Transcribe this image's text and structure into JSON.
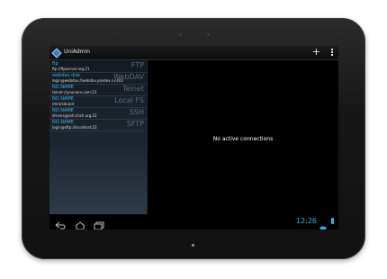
{
  "app": {
    "title": "UniAdmin"
  },
  "actionbar": {
    "add_icon": "plus-icon",
    "overflow_icon": "overflow-menu-icon"
  },
  "connections": [
    {
      "name": "ftp",
      "address": "ftp://ftpserver.org:21",
      "type": "FTP"
    },
    {
      "name": "webdav disk",
      "address": "login@webdav://webdav.yandex.ru:443",
      "type": "WebDAV"
    },
    {
      "name": "NO NAME",
      "address": "telnet://yourserv.com:23",
      "type": "Telnet"
    },
    {
      "name": "NO NAME",
      "address": "/mnt/sdcard",
      "type": "Local FS"
    },
    {
      "name": "NO NAME",
      "address": "drivers@ssh://ssh.org:22",
      "type": "SSH"
    },
    {
      "name": "NO NAME",
      "address": "login@sftp://localhost:22",
      "type": "SFTP"
    }
  ],
  "main": {
    "empty_message": "No active connections"
  },
  "statusbar": {
    "time": "12:26",
    "back_icon": "back-icon",
    "home_icon": "home-icon",
    "recents_icon": "recents-icon"
  },
  "colors": {
    "accent": "#33b5e5",
    "type_label": "#5f6a75"
  }
}
